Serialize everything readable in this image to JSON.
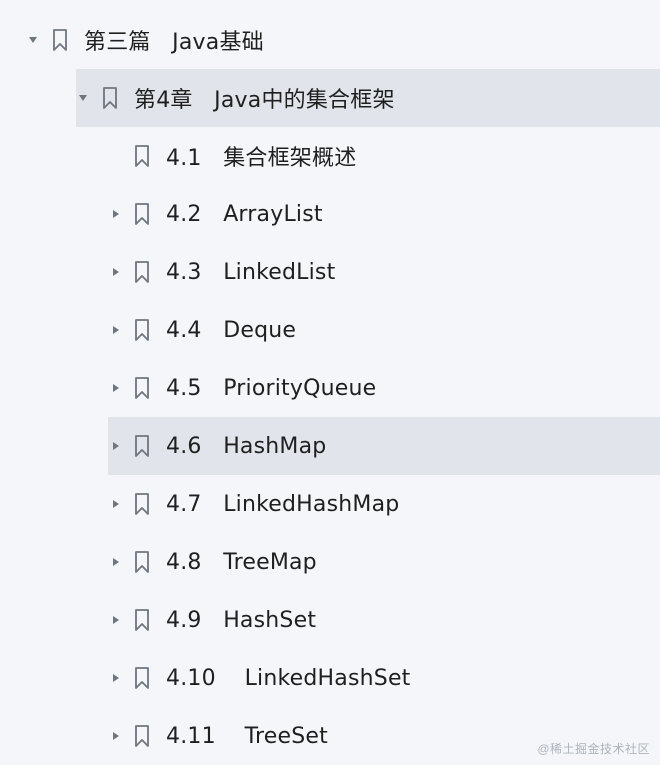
{
  "tree": {
    "part": {
      "label": "第三篇   Java基础",
      "expanded": true
    },
    "chapter": {
      "label": "第4章   Java中的集合框架",
      "expanded": true,
      "selected_background": "#e1e4ea"
    },
    "sections": [
      {
        "number": "4.1",
        "title": "集合框架概述",
        "has_children": false,
        "selected": false
      },
      {
        "number": "4.2",
        "title": "ArrayList",
        "has_children": true,
        "selected": false
      },
      {
        "number": "4.3",
        "title": "LinkedList",
        "has_children": true,
        "selected": false
      },
      {
        "number": "4.4",
        "title": "Deque",
        "has_children": true,
        "selected": false
      },
      {
        "number": "4.5",
        "title": "PriorityQueue",
        "has_children": true,
        "selected": false
      },
      {
        "number": "4.6",
        "title": "HashMap",
        "has_children": true,
        "selected": true
      },
      {
        "number": "4.7",
        "title": "LinkedHashMap",
        "has_children": true,
        "selected": false
      },
      {
        "number": "4.8",
        "title": "TreeMap",
        "has_children": true,
        "selected": false
      },
      {
        "number": "4.9",
        "title": "HashSet",
        "has_children": true,
        "selected": false
      },
      {
        "number": "4.10",
        "title": "LinkedHashSet",
        "has_children": true,
        "selected": false
      },
      {
        "number": "4.11",
        "title": "TreeSet",
        "has_children": true,
        "selected": false
      }
    ]
  },
  "icons": {
    "expanded": "triangle-down-icon",
    "collapsed": "triangle-right-icon",
    "bookmark": "bookmark-icon"
  },
  "colors": {
    "background": "#f4f6fa",
    "selected": "#e1e4ea",
    "text": "#1f1f1f",
    "icon": "#6f7680"
  },
  "watermark": "@稀土掘金技术社区"
}
